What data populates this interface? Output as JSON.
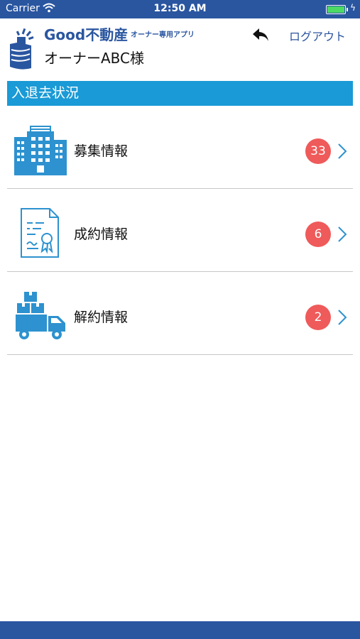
{
  "status_bar": {
    "carrier": "Carrier",
    "time": "12:50 AM",
    "battery_icon": "battery-icon",
    "wifi_icon": "wifi-icon"
  },
  "header": {
    "brand": "Good不動産",
    "brand_sub": "オーナー専用アプリ",
    "owner_name": "オーナーABC様",
    "back_icon": "back-arrow-icon",
    "logout_label": "ログアウト"
  },
  "section": {
    "title": "入退去状況"
  },
  "items": [
    {
      "label": "募集情報",
      "count": "33",
      "icon": "building-icon"
    },
    {
      "label": "成約情報",
      "count": "6",
      "icon": "contract-document-icon"
    },
    {
      "label": "解約情報",
      "count": "2",
      "icon": "moving-truck-icon"
    }
  ],
  "colors": {
    "brand_blue": "#2a56a0",
    "section_blue": "#1a9ad6",
    "badge_red": "#ef5a5a",
    "icon_blue": "#2d92cf"
  }
}
